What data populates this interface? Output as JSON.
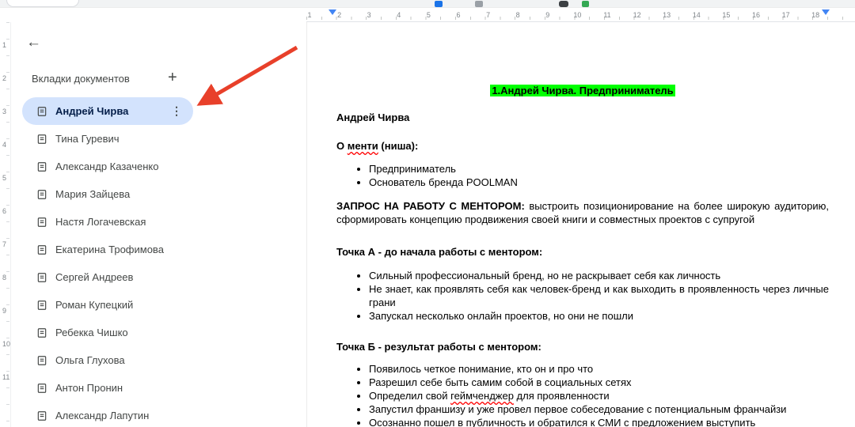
{
  "icons": {
    "back": "←",
    "add": "+",
    "kebab": "⋮"
  },
  "colors": {
    "selected_tab_bg": "#d3e3fd",
    "title_highlight": "#00ff00",
    "annotation_arrow": "#e8402a",
    "spellcheck_underline": "#ff0000"
  },
  "sidebar": {
    "title": "Вкладки документов",
    "items": [
      {
        "label": "Андрей Чирва",
        "selected": true
      },
      {
        "label": "Тина Гуревич",
        "selected": false
      },
      {
        "label": "Александр Казаченко",
        "selected": false
      },
      {
        "label": "Мария Зайцева",
        "selected": false
      },
      {
        "label": "Настя Логачевская",
        "selected": false
      },
      {
        "label": "Екатерина Трофимова",
        "selected": false
      },
      {
        "label": "Сергей Андреев",
        "selected": false
      },
      {
        "label": "Роман Купецкий",
        "selected": false
      },
      {
        "label": "Ребекка Чишко",
        "selected": false
      },
      {
        "label": "Ольга Глухова",
        "selected": false
      },
      {
        "label": "Антон Пронин",
        "selected": false
      },
      {
        "label": "Александр Лапутин",
        "selected": false
      }
    ]
  },
  "ruler": {
    "horizontal": [
      "1",
      "2",
      "3",
      "4",
      "5",
      "6",
      "7",
      "8",
      "9",
      "10",
      "11",
      "12",
      "13",
      "14",
      "15",
      "16",
      "17",
      "18"
    ],
    "vertical": [
      "1",
      "2",
      "3",
      "4",
      "5",
      "6",
      "7",
      "8",
      "9",
      "10",
      "11"
    ]
  },
  "document": {
    "title": "1.Андрей Чирва. Предприниматель",
    "name": "Андрей Чирва",
    "niche_label": "О менти (ниша):",
    "niche_items": [
      "Предприниматель",
      "Основатель бренда POOLMAN"
    ],
    "request_label": "ЗАПРОС НА РАБОТУ С МЕНТОРОМ:",
    "request_text": "выстроить позиционирование на более широкую аудиторию, сформировать концепцию продвижения своей книги и совместных проектов с супругой",
    "point_a_label": "Точка А - до начала работы с ментором:",
    "point_a_items": [
      "Сильный профессиональный бренд, но не раскрывает себя как личность",
      "Не знает, как проявлять себя как человек-бренд и как выходить в проявленность через личные грани",
      "Запускал несколько онлайн проектов, но они не пошли"
    ],
    "point_b_label": "Точка Б - результат работы с ментором:",
    "point_b_items": [
      "Появилось четкое понимание, кто он и про что",
      "Разрешил себе быть самим собой в социальных сетях",
      "Определил свой геймченджер для проявленности",
      "Запустил франшизу и уже провел первое собеседование с потенциальным франчайзи",
      "Осознанно пошел в публичность и обратился к СМИ с предложением выступить"
    ],
    "misspelled": [
      "менти",
      "геймченджер"
    ]
  }
}
